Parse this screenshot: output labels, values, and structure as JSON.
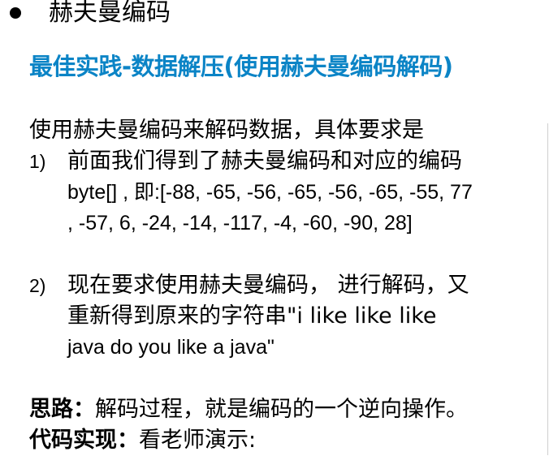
{
  "heading": "赫夫曼编码",
  "subtitle": "最佳实践-数据解压(使用赫夫曼编码解码)",
  "intro": "使用赫夫曼编码来解码数据，具体要求是",
  "items": [
    {
      "number": "1)",
      "lines": [
        "前面我们得到了赫夫曼编码和对应的编码",
        "byte[] , 即:[-88, -65, -56, -65, -56, -65, -55, 77",
        ", -57, 6, -24, -14, -117, -4, -60, -90, 28]"
      ]
    },
    {
      "number": "2)",
      "lines": [
        "现在要求使用赫夫曼编码， 进行解码，又",
        "重新得到原来的字符串\"i like like like",
        "java do you like a java\""
      ]
    }
  ],
  "idea": {
    "label": "思路：",
    "text": "解码过程，就是编码的一个逆向操作。"
  },
  "code": {
    "label": "代码实现：",
    "text": "看老师演示:"
  },
  "colors": {
    "subtitle": "#0b84c6",
    "text": "#000000",
    "background": "#ffffff"
  }
}
